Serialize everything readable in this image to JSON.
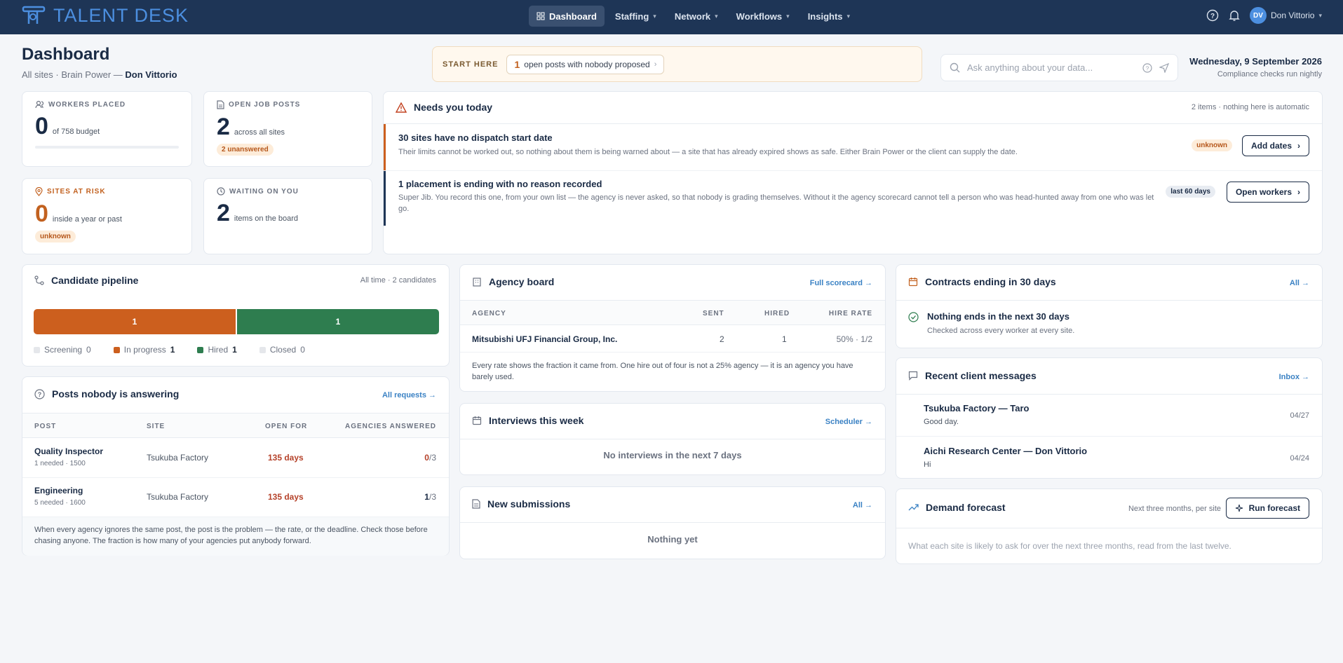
{
  "app": {
    "name": "TALENT DESK",
    "brand_color": "#4c8fe0",
    "nav_bg": "#1e3556"
  },
  "nav": {
    "items": [
      {
        "label": "Dashboard",
        "active": true
      },
      {
        "label": "Staffing"
      },
      {
        "label": "Network"
      },
      {
        "label": "Workflows"
      },
      {
        "label": "Insights"
      }
    ],
    "user_initials": "DV",
    "user_name": "Don Vittorio"
  },
  "header": {
    "title": "Dashboard",
    "sub_prefix": "All sites · Brain Power —",
    "sub_user": "Don Vittorio"
  },
  "start_here": {
    "label": "START HERE",
    "count": "1",
    "text": "open posts with nobody proposed"
  },
  "search": {
    "placeholder": "Ask anything about your data..."
  },
  "date": {
    "today": "Wednesday, 9 September 2026",
    "note": "Compliance checks run nightly"
  },
  "stats": {
    "workers": {
      "label": "WORKERS PLACED",
      "value": "0",
      "desc": "of 758 budget",
      "fill_fraction": 0
    },
    "jobs": {
      "label": "OPEN JOB POSTS",
      "value": "2",
      "desc": "across all sites",
      "badge": "2 unanswered"
    },
    "risk": {
      "label": "SITES AT RISK",
      "value": "0",
      "desc": "inside a year or past",
      "badge": "unknown"
    },
    "waiting": {
      "label": "WAITING ON YOU",
      "value": "2",
      "desc": "items on the board"
    }
  },
  "needs": {
    "title": "Needs you today",
    "meta": "2 items · nothing here is automatic",
    "items": [
      {
        "title": "30 sites have no dispatch start date",
        "body": "Their limits cannot be worked out, so nothing about them is being warned about — a site that has already expired shows as safe. Either Brain Power or the client can supply the date.",
        "badge": "unknown",
        "action": "Add dates"
      },
      {
        "title": "1 placement is ending with no reason recorded",
        "body": "Super Jib. You record this one, from your own list — the agency is never asked, so that nobody is grading themselves. Without it the agency scorecard cannot tell a person who was head-hunted away from one who was let go.",
        "badge": "last 60 days",
        "action": "Open workers"
      }
    ]
  },
  "pipeline": {
    "title": "Candidate pipeline",
    "meta": "All time · 2 candidates",
    "segments": [
      {
        "value": "1",
        "color": "#cc5f1e"
      },
      {
        "value": "1",
        "color": "#2e7d4f"
      }
    ],
    "legend": [
      {
        "label": "Screening",
        "value": "0",
        "color": "#e5e7eb"
      },
      {
        "label": "In progress",
        "value": "1",
        "color": "#cc5f1e"
      },
      {
        "label": "Hired",
        "value": "1",
        "color": "#2e7d4f"
      },
      {
        "label": "Closed",
        "value": "0",
        "color": "#e5e7eb"
      }
    ]
  },
  "posts": {
    "title": "Posts nobody is answering",
    "link": "All requests →",
    "headers": [
      "POST",
      "SITE",
      "OPEN FOR",
      "AGENCIES ANSWERED"
    ],
    "rows": [
      {
        "post": "Quality Inspector",
        "detail": "1 needed · 1500",
        "site": "Tsukuba Factory",
        "open": "135 days",
        "answered": "0",
        "total": "/3"
      },
      {
        "post": "Engineering",
        "detail": "5 needed · 1600",
        "site": "Tsukuba Factory",
        "open": "135 days",
        "answered": "1",
        "total": "/3"
      }
    ],
    "footer": "When every agency ignores the same post, the post is the problem — the rate, or the deadline. Check those before chasing anyone. The fraction is how many of your agencies put anybody forward."
  },
  "agency": {
    "title": "Agency board",
    "link": "Full scorecard →",
    "headers": [
      "AGENCY",
      "SENT",
      "HIRED",
      "HIRE RATE"
    ],
    "rows": [
      {
        "agency": "Mitsubishi UFJ Financial Group, Inc.",
        "sent": "2",
        "hired": "1",
        "rate": "50% · 1/2"
      }
    ],
    "footer": "Every rate shows the fraction it came from. One hire out of four is not a 25% agency — it is an agency you have barely used."
  },
  "interviews": {
    "title": "Interviews this week",
    "link": "Scheduler →",
    "empty": "No interviews in the next 7 days"
  },
  "submissions": {
    "title": "New submissions",
    "link": "All →",
    "empty": "Nothing yet"
  },
  "contracts": {
    "title": "Contracts ending in 30 days",
    "link": "All →",
    "empty_title": "Nothing ends in the next 30 days",
    "empty_sub": "Checked across every worker at every site."
  },
  "messages": {
    "title": "Recent client messages",
    "link": "Inbox →",
    "items": [
      {
        "from": "Tsukuba Factory — Taro",
        "text": "Good day.",
        "date": "04/27"
      },
      {
        "from": "Aichi Research Center — Don Vittorio",
        "text": "Hi",
        "date": "04/24"
      }
    ]
  },
  "forecast": {
    "title": "Demand forecast",
    "meta": "Next three months, per site",
    "action": "Run forecast",
    "desc": "What each site is likely to ask for over the next three months, read from the last twelve."
  }
}
